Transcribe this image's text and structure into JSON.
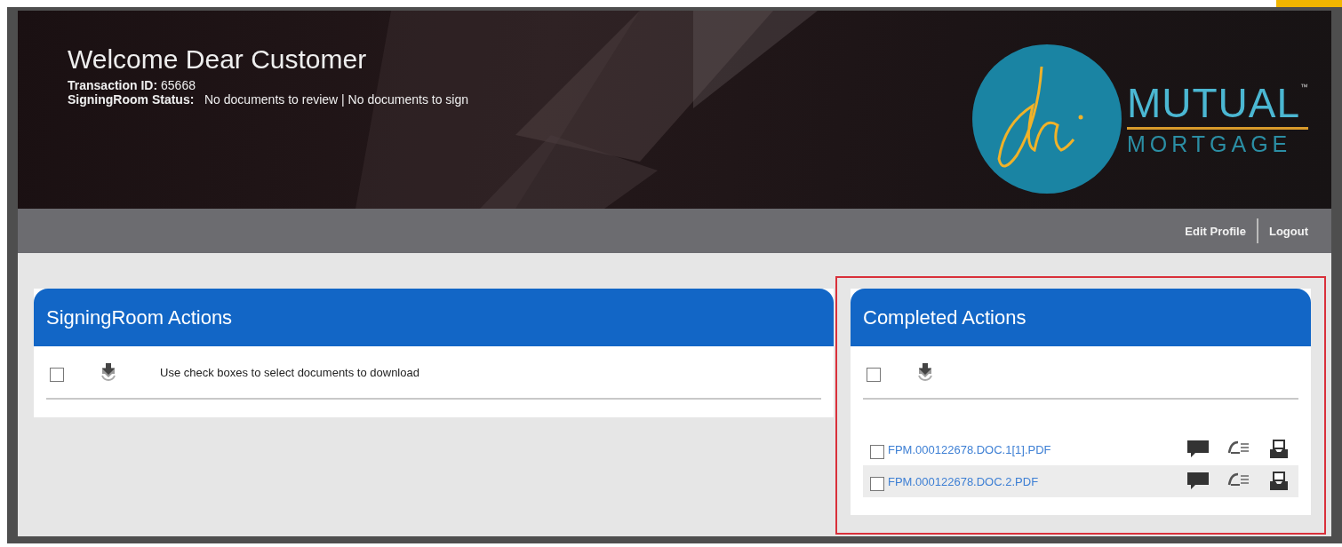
{
  "header": {
    "title": "Welcome Dear Customer",
    "transaction_label": "Transaction ID:",
    "transaction_id": "65668",
    "status_label": "SigningRoom Status:",
    "status_review": "No documents to review",
    "status_separator": "|",
    "status_sign": "No documents to sign",
    "logo": {
      "word_top": "MUTUAL",
      "trademark": "™",
      "word_bottom": "MORTGAGE"
    }
  },
  "nav_links": [
    {
      "label": "Edit Profile"
    },
    {
      "label": "Logout"
    }
  ],
  "panels": [
    {
      "title": "SigningRoom Actions",
      "highlighted": false,
      "select_all_checked": false,
      "hint": "Use check boxes to select documents to download"
    },
    {
      "title": "Completed Actions",
      "highlighted": true,
      "select_all_checked": false,
      "files": [
        {
          "name": "FPM.000122678.DOC.1[1].PDF",
          "checked": false
        },
        {
          "name": "FPM.000122678.DOC.2.PDF",
          "checked": false
        }
      ]
    }
  ]
}
